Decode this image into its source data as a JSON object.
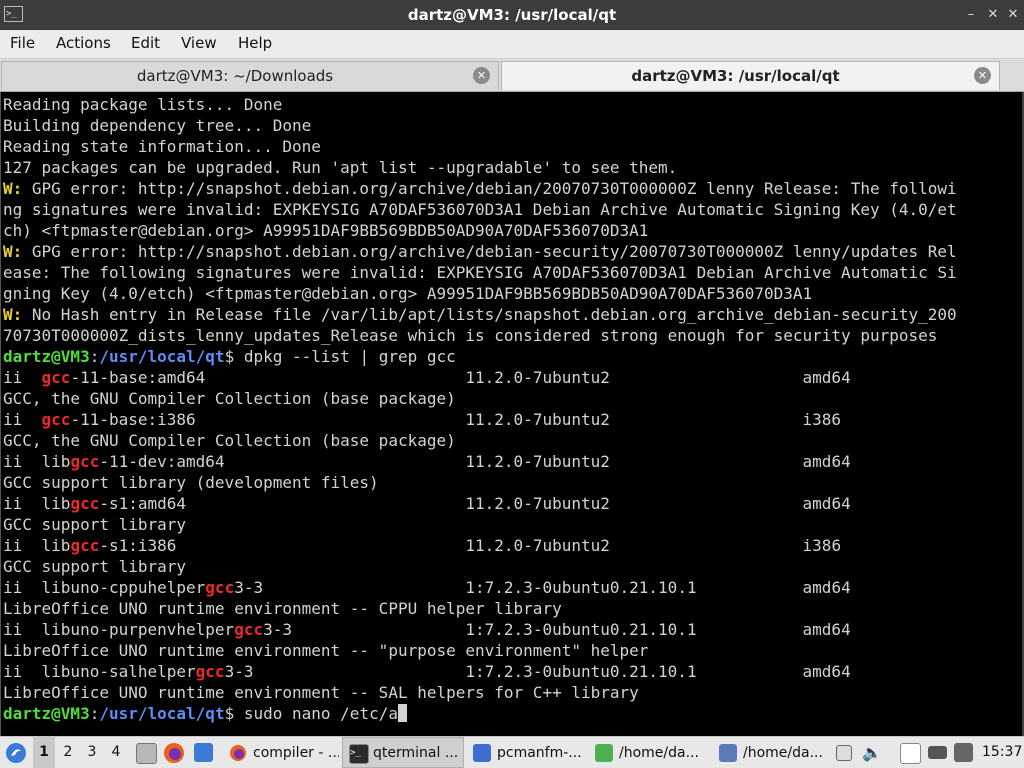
{
  "window": {
    "title": "dartz@VM3: /usr/local/qt",
    "app_icon": ">_",
    "controls": [
      "–",
      "✕",
      "✕"
    ]
  },
  "menu": [
    "File",
    "Actions",
    "Edit",
    "View",
    "Help"
  ],
  "tabs": [
    {
      "label": "dartz@VM3: ~/Downloads",
      "active": false
    },
    {
      "label": "dartz@VM3: /usr/local/qt",
      "active": true
    }
  ],
  "terminal": {
    "lines": [
      [
        {
          "t": "Reading package lists... Done"
        }
      ],
      [
        {
          "t": "Building dependency tree... Done"
        }
      ],
      [
        {
          "t": "Reading state information... Done"
        }
      ],
      [
        {
          "t": "127 packages can be upgraded. Run 'apt list --upgradable' to see them."
        }
      ],
      [
        {
          "t": "W:",
          "c": "warn"
        },
        {
          "t": " GPG error: http://snapshot.debian.org/archive/debian/20070730T000000Z lenny Release: The followi"
        }
      ],
      [
        {
          "t": "ng signatures were invalid: EXPKEYSIG A70DAF536070D3A1 Debian Archive Automatic Signing Key (4.0/et"
        }
      ],
      [
        {
          "t": "ch) <ftpmaster@debian.org> A99951DAF9BB569BDB50AD90A70DAF536070D3A1"
        }
      ],
      [
        {
          "t": "W:",
          "c": "warn"
        },
        {
          "t": " GPG error: http://snapshot.debian.org/archive/debian-security/20070730T000000Z lenny/updates Rel"
        }
      ],
      [
        {
          "t": "ease: The following signatures were invalid: EXPKEYSIG A70DAF536070D3A1 Debian Archive Automatic Si"
        }
      ],
      [
        {
          "t": "gning Key (4.0/etch) <ftpmaster@debian.org> A99951DAF9BB569BDB50AD90A70DAF536070D3A1"
        }
      ],
      [
        {
          "t": "W:",
          "c": "warn"
        },
        {
          "t": " No Hash entry in Release file /var/lib/apt/lists/snapshot.debian.org_archive_debian-security_200"
        }
      ],
      [
        {
          "t": "70730T000000Z_dists_lenny_updates_Release which is considered strong enough for security purposes"
        }
      ],
      [
        {
          "t": "dartz@VM3",
          "c": "prompt-user"
        },
        {
          "t": ":"
        },
        {
          "t": "/usr/local/qt",
          "c": "prompt-path"
        },
        {
          "t": "$ dpkg --list | grep gcc"
        }
      ],
      [
        {
          "t": "ii  "
        },
        {
          "t": "gcc",
          "c": "hl"
        },
        {
          "t": "-11-base:amd64                           11.2.0-7ubuntu2                    amd64"
        }
      ],
      [
        {
          "t": "GCC, the GNU Compiler Collection (base package)"
        }
      ],
      [
        {
          "t": "ii  "
        },
        {
          "t": "gcc",
          "c": "hl"
        },
        {
          "t": "-11-base:i386                            11.2.0-7ubuntu2                    i386"
        }
      ],
      [
        {
          "t": "GCC, the GNU Compiler Collection (base package)"
        }
      ],
      [
        {
          "t": "ii  lib"
        },
        {
          "t": "gcc",
          "c": "hl"
        },
        {
          "t": "-11-dev:amd64                         11.2.0-7ubuntu2                    amd64"
        }
      ],
      [
        {
          "t": "GCC support library (development files)"
        }
      ],
      [
        {
          "t": "ii  lib"
        },
        {
          "t": "gcc",
          "c": "hl"
        },
        {
          "t": "-s1:amd64                             11.2.0-7ubuntu2                    amd64"
        }
      ],
      [
        {
          "t": "GCC support library"
        }
      ],
      [
        {
          "t": "ii  lib"
        },
        {
          "t": "gcc",
          "c": "hl"
        },
        {
          "t": "-s1:i386                              11.2.0-7ubuntu2                    i386"
        }
      ],
      [
        {
          "t": "GCC support library"
        }
      ],
      [
        {
          "t": "ii  libuno-cppuhelper"
        },
        {
          "t": "gcc",
          "c": "hl"
        },
        {
          "t": "3-3                     1:7.2.3-0ubuntu0.21.10.1           amd64"
        }
      ],
      [
        {
          "t": "LibreOffice UNO runtime environment -- CPPU helper library"
        }
      ],
      [
        {
          "t": "ii  libuno-purpenvhelper"
        },
        {
          "t": "gcc",
          "c": "hl"
        },
        {
          "t": "3-3                  1:7.2.3-0ubuntu0.21.10.1           amd64"
        }
      ],
      [
        {
          "t": "LibreOffice UNO runtime environment -- \"purpose environment\" helper"
        }
      ],
      [
        {
          "t": "ii  libuno-salhelper"
        },
        {
          "t": "gcc",
          "c": "hl"
        },
        {
          "t": "3-3                      1:7.2.3-0ubuntu0.21.10.1           amd64"
        }
      ],
      [
        {
          "t": "LibreOffice UNO runtime environment -- SAL helpers for C++ library"
        }
      ],
      [
        {
          "t": "dartz@VM3",
          "c": "prompt-user"
        },
        {
          "t": ":"
        },
        {
          "t": "/usr/local/qt",
          "c": "prompt-path"
        },
        {
          "t": "$ sudo nano /etc/a"
        }
      ]
    ]
  },
  "taskbar": {
    "workspaces": [
      "1",
      "2",
      "3",
      "4"
    ],
    "active_workspace": "1",
    "launchers": [
      "menu-icon",
      "files-icon",
      "firefox-icon",
      "desktop-icon"
    ],
    "tasks": [
      {
        "label": "compiler - ...",
        "icon": "firefox-icon",
        "active": false
      },
      {
        "label": "qterminal ...",
        "icon": "terminal-icon",
        "active": true
      },
      {
        "label": "pcmanfm-...",
        "icon": "folder-icon",
        "active": false
      },
      {
        "label": "/home/da...",
        "icon": "file-icon",
        "active": false
      },
      {
        "label": "/home/da...",
        "icon": "editor-icon",
        "active": false
      }
    ],
    "clock": "15:37",
    "colors": {
      "accent": "#3a7bd5",
      "firefox": "#e8611c",
      "terminal": "#2b2b2b",
      "folder": "#3f6ed0"
    }
  }
}
